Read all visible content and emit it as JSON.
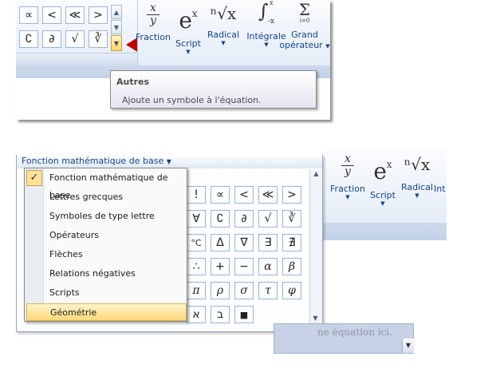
{
  "top": {
    "symbols_row1": [
      "∝",
      "<",
      "≪",
      ">"
    ],
    "symbols_row2": [
      "∁",
      "∂",
      "√",
      "∛"
    ],
    "tools": [
      {
        "glyph_top": "x",
        "glyph_bottom": "y",
        "label": "Fraction"
      },
      {
        "glyph": "e",
        "sup": "x",
        "label": "Script"
      },
      {
        "glyph": "ⁿ√x",
        "label": "Radical"
      },
      {
        "glyph": "∫",
        "sup": "x",
        "sub": "-x",
        "label": "Intégrale"
      },
      {
        "glyph": "Σ",
        "sub": "i=0",
        "label_line1": "Grand",
        "label_line2": "opérateur"
      }
    ],
    "more_icon": "more-arrow-icon"
  },
  "tooltip": {
    "title": "Autres",
    "description": "Ajoute un symbole à l'équation."
  },
  "bottom": {
    "header_label": "Fonction mathématique de base",
    "menu_items": [
      {
        "label": "Fonction mathématique de base",
        "checked": true
      },
      {
        "label": "Lettres grecques"
      },
      {
        "label": "Symboles de type lettre"
      },
      {
        "label": "Opérateurs"
      },
      {
        "label": "Flèches"
      },
      {
        "label": "Relations négatives"
      },
      {
        "label": "Scripts"
      },
      {
        "label": "Géométrie",
        "highlighted": true
      }
    ],
    "grid_rows": [
      [
        "!",
        "∝",
        "<",
        "≪",
        ">"
      ],
      [
        "∀",
        "∁",
        "∂",
        "√",
        "∛"
      ],
      [
        "°C",
        "Δ",
        "∇",
        "∃",
        "∄"
      ],
      [
        "∴",
        "+",
        "−",
        "α",
        "β"
      ],
      [
        "π",
        "ρ",
        "σ",
        "τ",
        "φ"
      ],
      [
        "א",
        "ב",
        "■",
        "",
        ""
      ]
    ],
    "right_tools": [
      {
        "glyph_top": "x",
        "glyph_bottom": "y",
        "label": "Fraction"
      },
      {
        "glyph": "e",
        "sup": "x",
        "label": "Script"
      },
      {
        "glyph": "ⁿ√x",
        "label": "Radical"
      },
      {
        "label": "Int"
      }
    ],
    "equation_placeholder": "ne équation ici."
  },
  "colors": {
    "accent_red": "#c00000",
    "highlight": "#ffe29a",
    "ribbon_blue": "#15428b"
  }
}
